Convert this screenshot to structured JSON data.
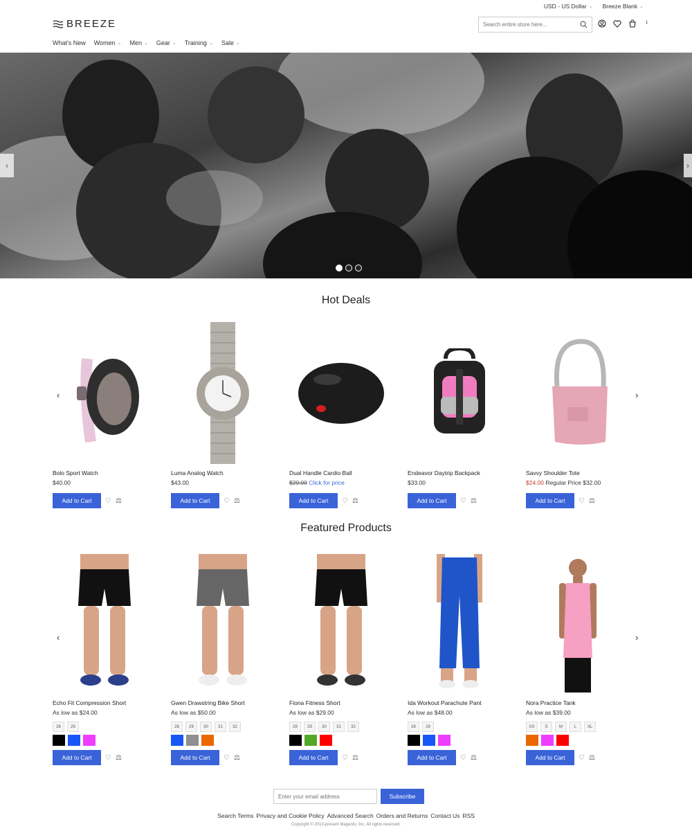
{
  "topbar": {
    "currency": "USD - US Dollar",
    "store": "Breeze Blank"
  },
  "header": {
    "logo": "BREEZE",
    "search_placeholder": "Search entire store here...",
    "cart_count": "1"
  },
  "nav": [
    {
      "label": "What's New",
      "has_dropdown": false
    },
    {
      "label": "Women",
      "has_dropdown": true
    },
    {
      "label": "Men",
      "has_dropdown": true
    },
    {
      "label": "Gear",
      "has_dropdown": true
    },
    {
      "label": "Training",
      "has_dropdown": true
    },
    {
      "label": "Sale",
      "has_dropdown": true
    }
  ],
  "hero": {
    "slides": 3,
    "active_slide": 1
  },
  "hot_deals": {
    "title": "Hot Deals",
    "products": [
      {
        "name": "Bolo Sport Watch",
        "price": "$40.00",
        "icon": "sport-watch"
      },
      {
        "name": "Luma Analog Watch",
        "price": "$43.00",
        "icon": "analog-watch"
      },
      {
        "name": "Dual Handle Cardio Ball",
        "old_price": "$20.00",
        "price_link": "Click for price",
        "icon": "cardio-ball"
      },
      {
        "name": "Endeavor Daytrip Backpack",
        "price": "$33.00",
        "icon": "backpack"
      },
      {
        "name": "Savvy Shoulder Tote",
        "special_price": "$24.00",
        "regular_price": "Regular Price $32.00",
        "icon": "tote-bag"
      }
    ],
    "add_label": "Add to Cart"
  },
  "featured": {
    "title": "Featured Products",
    "products": [
      {
        "name": "Echo Fit Compression Short",
        "price": "As low as $24.00",
        "sizes": [
          "28",
          "29"
        ],
        "colors": [
          "#000000",
          "#1857f7",
          "#ef3dff"
        ]
      },
      {
        "name": "Gwen Drawstring Bike Short",
        "price": "As low as $50.00",
        "sizes": [
          "28",
          "29",
          "30",
          "31",
          "32"
        ],
        "colors": [
          "#1857f7",
          "#8f8f8f",
          "#eb6703"
        ]
      },
      {
        "name": "Fiona Fitness Short",
        "price": "As low as $29.00",
        "sizes": [
          "28",
          "29",
          "30",
          "31",
          "32"
        ],
        "colors": [
          "#000000",
          "#53a828",
          "#ff0000"
        ]
      },
      {
        "name": "Ida Workout Parachute Pant",
        "price": "As low as $48.00",
        "sizes": [
          "28",
          "29"
        ],
        "colors": [
          "#000000",
          "#1857f7",
          "#ef3dff"
        ]
      },
      {
        "name": "Nora Practice Tank",
        "price": "As low as $39.00",
        "sizes": [
          "XS",
          "S",
          "M",
          "L",
          "XL"
        ],
        "colors": [
          "#eb6703",
          "#ef3dff",
          "#ff0000"
        ]
      }
    ],
    "add_label": "Add to Cart"
  },
  "footer": {
    "email_placeholder": "Enter your email address",
    "subscribe": "Subscribe",
    "links": [
      "Search Terms",
      "Privacy and Cookie Policy",
      "Advanced Search",
      "Orders and Returns",
      "Contact Us",
      "RSS"
    ],
    "copyright": "Copyright © 2013-present Magento, Inc. All rights reserved."
  },
  "colors": {
    "accent": "#3a63d8",
    "sale_red": "#c0392b"
  }
}
